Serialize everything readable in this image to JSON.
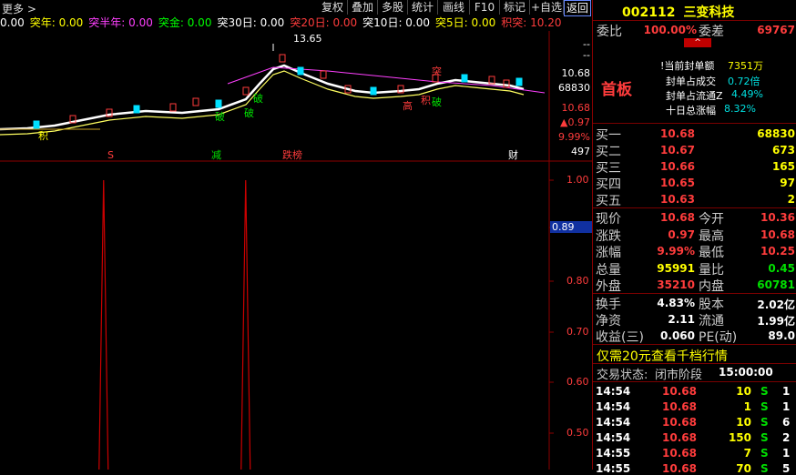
{
  "toolbar": {
    "more": "更多 >",
    "buttons": [
      "复权",
      "叠加",
      "多股",
      "统计",
      "画线",
      "F10",
      "标记",
      "+自选",
      "返回"
    ]
  },
  "indicators": [
    {
      "label": "0.00",
      "color": "#ffffff"
    },
    {
      "label": "突年: 0.00",
      "color": "#ffff00"
    },
    {
      "label": "突半年: 0.00",
      "color": "#ff40ff"
    },
    {
      "label": "突金: 0.00",
      "color": "#00ff00"
    },
    {
      "label": "突30日: 0.00",
      "color": "#ffffff"
    },
    {
      "label": "突20日: 0.00",
      "color": "#ff3c3c"
    },
    {
      "label": "突10日: 0.00",
      "color": "#ffffff"
    },
    {
      "label": "突5日: 0.00",
      "color": "#ffff00"
    },
    {
      "label": "积突: 10.20",
      "color": "#ff3c3c"
    }
  ],
  "chart_upper": {
    "high_label": "13.65",
    "markers": [
      "积",
      "S",
      "减",
      "跌榜",
      "财"
    ],
    "tags": [
      "突",
      "高",
      "积",
      "破",
      "破",
      "破",
      "破"
    ],
    "right_labels": [
      "--",
      "--",
      "10.68",
      "68830",
      "10.68",
      "▲0.97",
      "9.99%",
      "497"
    ]
  },
  "chart_lower": {
    "y_labels": [
      "1.00",
      "0.89",
      "0.80",
      "0.70",
      "0.60",
      "0.50"
    ],
    "spikes_x_pct": [
      0.175,
      0.415
    ]
  },
  "stock": {
    "code": "002112",
    "name": "三变科技",
    "weibi_label": "委比",
    "weibi": "100.00%",
    "weicha_label": "委差",
    "weicha": "69767",
    "board": "首板",
    "seal_amount_label": "!当前封单额",
    "seal_amount": "7351万",
    "seal_deal_label": "封单占成交",
    "seal_deal": "0.72倍",
    "seal_float_label": "封单占流通Z",
    "seal_float": "4.49%",
    "ten_day_label": "十日总涨幅",
    "ten_day": "8.32%"
  },
  "bids": [
    {
      "label": "买一",
      "price": "10.68",
      "vol": "68830"
    },
    {
      "label": "买二",
      "price": "10.67",
      "vol": "673"
    },
    {
      "label": "买三",
      "price": "10.66",
      "vol": "165"
    },
    {
      "label": "买四",
      "price": "10.65",
      "vol": "97"
    },
    {
      "label": "买五",
      "price": "10.63",
      "vol": "2"
    }
  ],
  "quote": [
    {
      "l1": "现价",
      "v1": "10.68",
      "l2": "今开",
      "v2": "10.36"
    },
    {
      "l1": "涨跌",
      "v1": "0.97",
      "l2": "最高",
      "v2": "10.68"
    },
    {
      "l1": "涨幅",
      "v1": "9.99%",
      "l2": "最低",
      "v2": "10.25"
    },
    {
      "l1": "总量",
      "v1": "95991",
      "l2": "量比",
      "v2": "0.45"
    },
    {
      "l1": "外盘",
      "v1": "35210",
      "l2": "内盘",
      "v2": "60781"
    }
  ],
  "fund": [
    {
      "l1": "换手",
      "v1": "4.83%",
      "l2": "股本",
      "v2": "2.02亿"
    },
    {
      "l1": "净资",
      "v1": "2.11",
      "l2": "流通",
      "v2": "1.99亿"
    },
    {
      "l1": "收益(三)",
      "v1": "0.060",
      "l2": "PE(动)",
      "v2": "89.0"
    }
  ],
  "promo": "仅需20元查看千档行情",
  "trade_status_label": "交易状态:",
  "trade_status": "闭市阶段",
  "trade_time": "15:00:00",
  "ticks": [
    {
      "t": "14:54",
      "p": "10.68",
      "v": "10",
      "s": "S",
      "n": "1"
    },
    {
      "t": "14:54",
      "p": "10.68",
      "v": "1",
      "s": "S",
      "n": "1"
    },
    {
      "t": "14:54",
      "p": "10.68",
      "v": "10",
      "s": "S",
      "n": "6"
    },
    {
      "t": "14:54",
      "p": "10.68",
      "v": "150",
      "s": "S",
      "n": "2"
    },
    {
      "t": "14:55",
      "p": "10.68",
      "v": "7",
      "s": "S",
      "n": "1"
    },
    {
      "t": "14:55",
      "p": "10.68",
      "v": "70",
      "s": "S",
      "n": "5"
    }
  ]
}
